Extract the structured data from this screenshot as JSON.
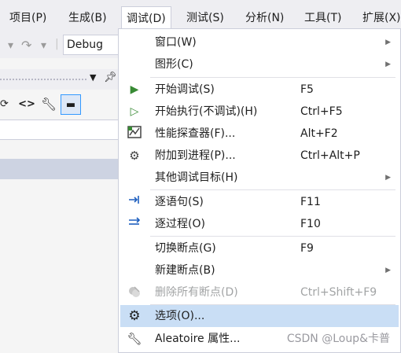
{
  "menubar": {
    "items": [
      {
        "label": "项目(P)"
      },
      {
        "label": "生成(B)"
      },
      {
        "label": "调试(D)"
      },
      {
        "label": "测试(S)"
      },
      {
        "label": "分析(N)"
      },
      {
        "label": "工具(T)"
      },
      {
        "label": "扩展(X)"
      }
    ]
  },
  "toolbar": {
    "config_value": "Debug"
  },
  "colors": {
    "menu_highlight": "#c9def5",
    "menu_bg": "#eeeef2",
    "play_green": "#388a34",
    "disabled_text": "#a2a4a5"
  },
  "debug_menu": {
    "items": [
      {
        "label": "窗口(W)",
        "shortcut": "",
        "submenu": true,
        "icon": ""
      },
      {
        "label": "图形(C)",
        "shortcut": "",
        "submenu": true,
        "icon": ""
      },
      {
        "label": "开始调试(S)",
        "shortcut": "F5",
        "submenu": false,
        "icon": "play-filled-icon"
      },
      {
        "label": "开始执行(不调试)(H)",
        "shortcut": "Ctrl+F5",
        "submenu": false,
        "icon": "play-outline-icon"
      },
      {
        "label": "性能探查器(F)...",
        "shortcut": "Alt+F2",
        "submenu": false,
        "icon": "profiler-icon"
      },
      {
        "label": "附加到进程(P)...",
        "shortcut": "Ctrl+Alt+P",
        "submenu": false,
        "icon": "attach-gears-icon"
      },
      {
        "label": "其他调试目标(H)",
        "shortcut": "",
        "submenu": true,
        "icon": ""
      },
      {
        "label": "逐语句(S)",
        "shortcut": "F11",
        "submenu": false,
        "icon": "step-into-icon"
      },
      {
        "label": "逐过程(O)",
        "shortcut": "F10",
        "submenu": false,
        "icon": "step-over-icon"
      },
      {
        "label": "切换断点(G)",
        "shortcut": "F9",
        "submenu": false,
        "icon": ""
      },
      {
        "label": "新建断点(B)",
        "shortcut": "",
        "submenu": true,
        "icon": ""
      },
      {
        "label": "删除所有断点(D)",
        "shortcut": "Ctrl+Shift+F9",
        "submenu": false,
        "icon": "delete-breakpoints-icon",
        "disabled": true
      },
      {
        "label": "选项(O)...",
        "shortcut": "",
        "submenu": false,
        "icon": "gear-icon",
        "highlighted": true
      },
      {
        "label": "Aleatoire 属性...",
        "shortcut": "",
        "submenu": false,
        "icon": "wrench-icon"
      }
    ]
  },
  "watermark": "CSDN @Loup&卡普"
}
